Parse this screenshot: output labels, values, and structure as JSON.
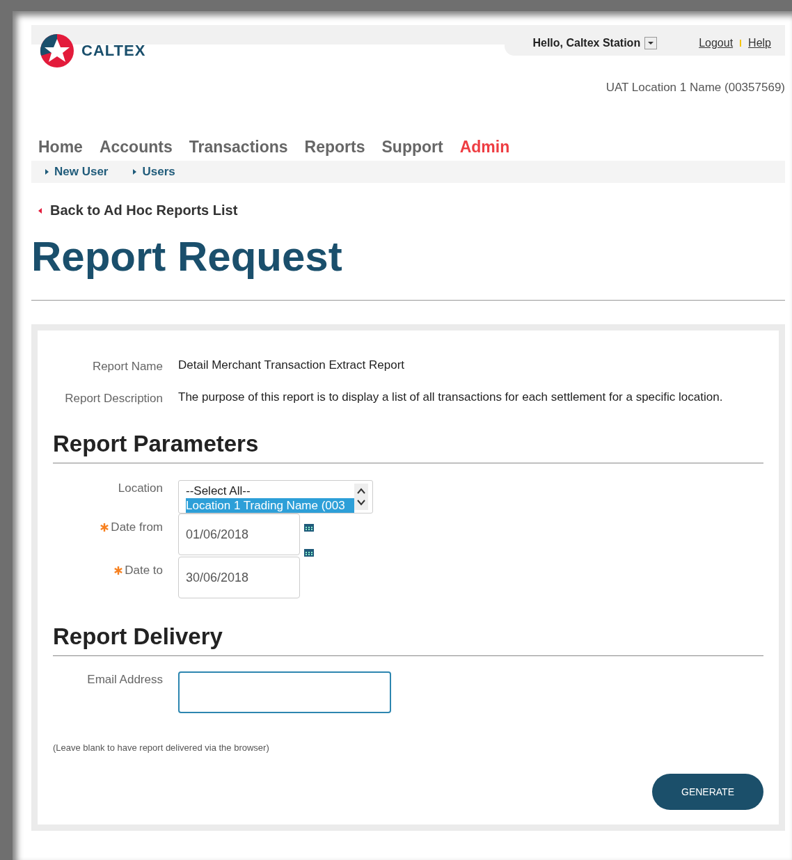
{
  "header": {
    "logo_text": "CALTEX",
    "greeting": "Hello, Caltex Station",
    "links": [
      {
        "label": "Logout"
      },
      {
        "label": "Help"
      }
    ],
    "location": "UAT Location 1 Name (00357569)"
  },
  "nav": [
    {
      "label": "Home",
      "selected": false
    },
    {
      "label": "Accounts",
      "selected": false
    },
    {
      "label": "Transactions",
      "selected": false
    },
    {
      "label": "Reports",
      "selected": false
    },
    {
      "label": "Support",
      "selected": false
    },
    {
      "label": "Admin",
      "selected": true
    }
  ],
  "subnav": [
    "New User",
    "Users"
  ],
  "back_link": "Back to Ad Hoc Reports List",
  "title": "Report Request",
  "details": [
    {
      "label": "Report Name",
      "value": "Detail Merchant Transaction Extract Report"
    },
    {
      "label": "Report Description",
      "value": "The purpose of this report is to display a list of all transactions for each settlement for a specific location."
    }
  ],
  "parameters": {
    "heading": "Report Parameters",
    "location": {
      "label": "Location",
      "options": [
        {
          "label": "--Select All--",
          "selected": false
        },
        {
          "label": "Location 1 Trading Name (003",
          "selected": true
        }
      ]
    },
    "dates": [
      {
        "label": "Date from",
        "required": true,
        "value": "01/06/2018"
      },
      {
        "label": "Date to",
        "required": true,
        "value": "30/06/2018"
      }
    ]
  },
  "delivery": {
    "heading": "Report Delivery",
    "email": {
      "label": "Email Address",
      "focused": true
    },
    "note": "(Leave blank to have report delivered via the browser)"
  },
  "generate_button": "GENERATE"
}
